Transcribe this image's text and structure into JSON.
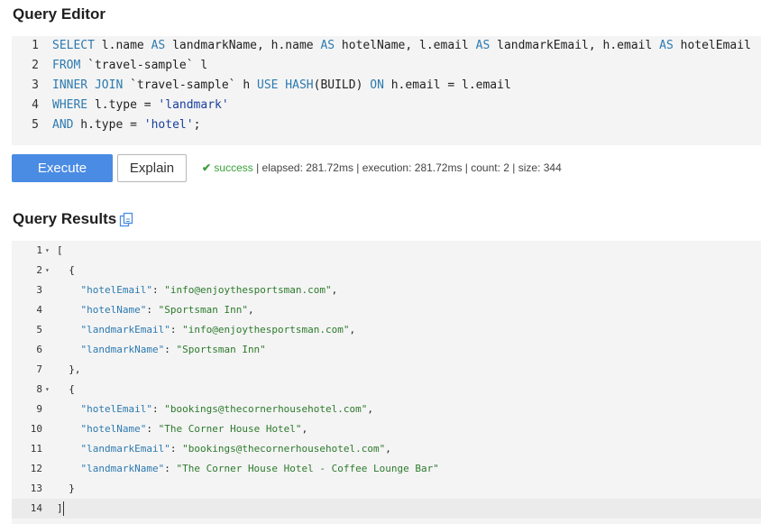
{
  "query_editor": {
    "title": "Query Editor",
    "lines": [
      {
        "num": "1",
        "tokens": [
          {
            "t": "kw",
            "v": "SELECT"
          },
          {
            "t": "id",
            "v": " l.name "
          },
          {
            "t": "kw",
            "v": "AS"
          },
          {
            "t": "id",
            "v": " landmarkName, h.name "
          },
          {
            "t": "kw",
            "v": "AS"
          },
          {
            "t": "id",
            "v": " hotelName, l.email "
          },
          {
            "t": "kw",
            "v": "AS"
          },
          {
            "t": "id",
            "v": " landmarkEmail, h.email "
          },
          {
            "t": "kw",
            "v": "AS"
          },
          {
            "t": "id",
            "v": " hotelEmail"
          }
        ]
      },
      {
        "num": "2",
        "tokens": [
          {
            "t": "kw",
            "v": "FROM"
          },
          {
            "t": "id",
            "v": " `travel-sample` l"
          }
        ]
      },
      {
        "num": "3",
        "tokens": [
          {
            "t": "kw",
            "v": "INNER JOIN"
          },
          {
            "t": "id",
            "v": " `travel-sample` h "
          },
          {
            "t": "kw",
            "v": "USE HASH"
          },
          {
            "t": "id",
            "v": "(BUILD) "
          },
          {
            "t": "kw",
            "v": "ON"
          },
          {
            "t": "id",
            "v": " h.email = l.email"
          }
        ]
      },
      {
        "num": "4",
        "tokens": [
          {
            "t": "kw",
            "v": "WHERE"
          },
          {
            "t": "id",
            "v": " l.type = "
          },
          {
            "t": "str",
            "v": "'landmark'"
          }
        ]
      },
      {
        "num": "5",
        "tokens": [
          {
            "t": "kw",
            "v": "AND"
          },
          {
            "t": "id",
            "v": " h.type = "
          },
          {
            "t": "str",
            "v": "'hotel'"
          },
          {
            "t": "id",
            "v": ";"
          }
        ]
      }
    ]
  },
  "toolbar": {
    "execute_label": "Execute",
    "explain_label": "Explain",
    "status_word": "success",
    "status_detail": " | elapsed: 281.72ms | execution: 281.72ms | count: 2 | size: 344"
  },
  "results": {
    "title": "Query Results",
    "lines": [
      {
        "num": "1",
        "fold": "▾",
        "tokens": [
          {
            "t": "jpunc",
            "v": "["
          }
        ]
      },
      {
        "num": "2",
        "fold": "▾",
        "tokens": [
          {
            "t": "jpunc",
            "v": "  {"
          }
        ]
      },
      {
        "num": "3",
        "fold": "",
        "tokens": [
          {
            "t": "jpunc",
            "v": "    "
          },
          {
            "t": "jkey",
            "v": "\"hotelEmail\""
          },
          {
            "t": "jpunc",
            "v": ": "
          },
          {
            "t": "jstr",
            "v": "\"info@enjoythesportsman.com\""
          },
          {
            "t": "jpunc",
            "v": ","
          }
        ]
      },
      {
        "num": "4",
        "fold": "",
        "tokens": [
          {
            "t": "jpunc",
            "v": "    "
          },
          {
            "t": "jkey",
            "v": "\"hotelName\""
          },
          {
            "t": "jpunc",
            "v": ": "
          },
          {
            "t": "jstr",
            "v": "\"Sportsman Inn\""
          },
          {
            "t": "jpunc",
            "v": ","
          }
        ]
      },
      {
        "num": "5",
        "fold": "",
        "tokens": [
          {
            "t": "jpunc",
            "v": "    "
          },
          {
            "t": "jkey",
            "v": "\"landmarkEmail\""
          },
          {
            "t": "jpunc",
            "v": ": "
          },
          {
            "t": "jstr",
            "v": "\"info@enjoythesportsman.com\""
          },
          {
            "t": "jpunc",
            "v": ","
          }
        ]
      },
      {
        "num": "6",
        "fold": "",
        "tokens": [
          {
            "t": "jpunc",
            "v": "    "
          },
          {
            "t": "jkey",
            "v": "\"landmarkName\""
          },
          {
            "t": "jpunc",
            "v": ": "
          },
          {
            "t": "jstr",
            "v": "\"Sportsman Inn\""
          }
        ]
      },
      {
        "num": "7",
        "fold": "",
        "tokens": [
          {
            "t": "jpunc",
            "v": "  },"
          }
        ]
      },
      {
        "num": "8",
        "fold": "▾",
        "tokens": [
          {
            "t": "jpunc",
            "v": "  {"
          }
        ]
      },
      {
        "num": "9",
        "fold": "",
        "tokens": [
          {
            "t": "jpunc",
            "v": "    "
          },
          {
            "t": "jkey",
            "v": "\"hotelEmail\""
          },
          {
            "t": "jpunc",
            "v": ": "
          },
          {
            "t": "jstr",
            "v": "\"bookings@thecornerhousehotel.com\""
          },
          {
            "t": "jpunc",
            "v": ","
          }
        ]
      },
      {
        "num": "10",
        "fold": "",
        "tokens": [
          {
            "t": "jpunc",
            "v": "    "
          },
          {
            "t": "jkey",
            "v": "\"hotelName\""
          },
          {
            "t": "jpunc",
            "v": ": "
          },
          {
            "t": "jstr",
            "v": "\"The Corner House Hotel\""
          },
          {
            "t": "jpunc",
            "v": ","
          }
        ]
      },
      {
        "num": "11",
        "fold": "",
        "tokens": [
          {
            "t": "jpunc",
            "v": "    "
          },
          {
            "t": "jkey",
            "v": "\"landmarkEmail\""
          },
          {
            "t": "jpunc",
            "v": ": "
          },
          {
            "t": "jstr",
            "v": "\"bookings@thecornerhousehotel.com\""
          },
          {
            "t": "jpunc",
            "v": ","
          }
        ]
      },
      {
        "num": "12",
        "fold": "",
        "tokens": [
          {
            "t": "jpunc",
            "v": "    "
          },
          {
            "t": "jkey",
            "v": "\"landmarkName\""
          },
          {
            "t": "jpunc",
            "v": ": "
          },
          {
            "t": "jstr",
            "v": "\"The Corner House Hotel - Coffee Lounge Bar\""
          }
        ]
      },
      {
        "num": "13",
        "fold": "",
        "tokens": [
          {
            "t": "jpunc",
            "v": "  }"
          }
        ]
      },
      {
        "num": "14",
        "fold": "",
        "active": true,
        "tokens": [
          {
            "t": "jpunc",
            "v": "]"
          }
        ]
      }
    ]
  },
  "colors": {
    "accent": "#4a8be4",
    "success": "#3aa13a",
    "keyword": "#2d7ab0",
    "json_string": "#2d7a2d",
    "editor_bg": "#f4f4f4"
  },
  "icons": {
    "copy": "copy-icon",
    "success": "checkmark-icon",
    "fold": "chevron-down-icon"
  }
}
